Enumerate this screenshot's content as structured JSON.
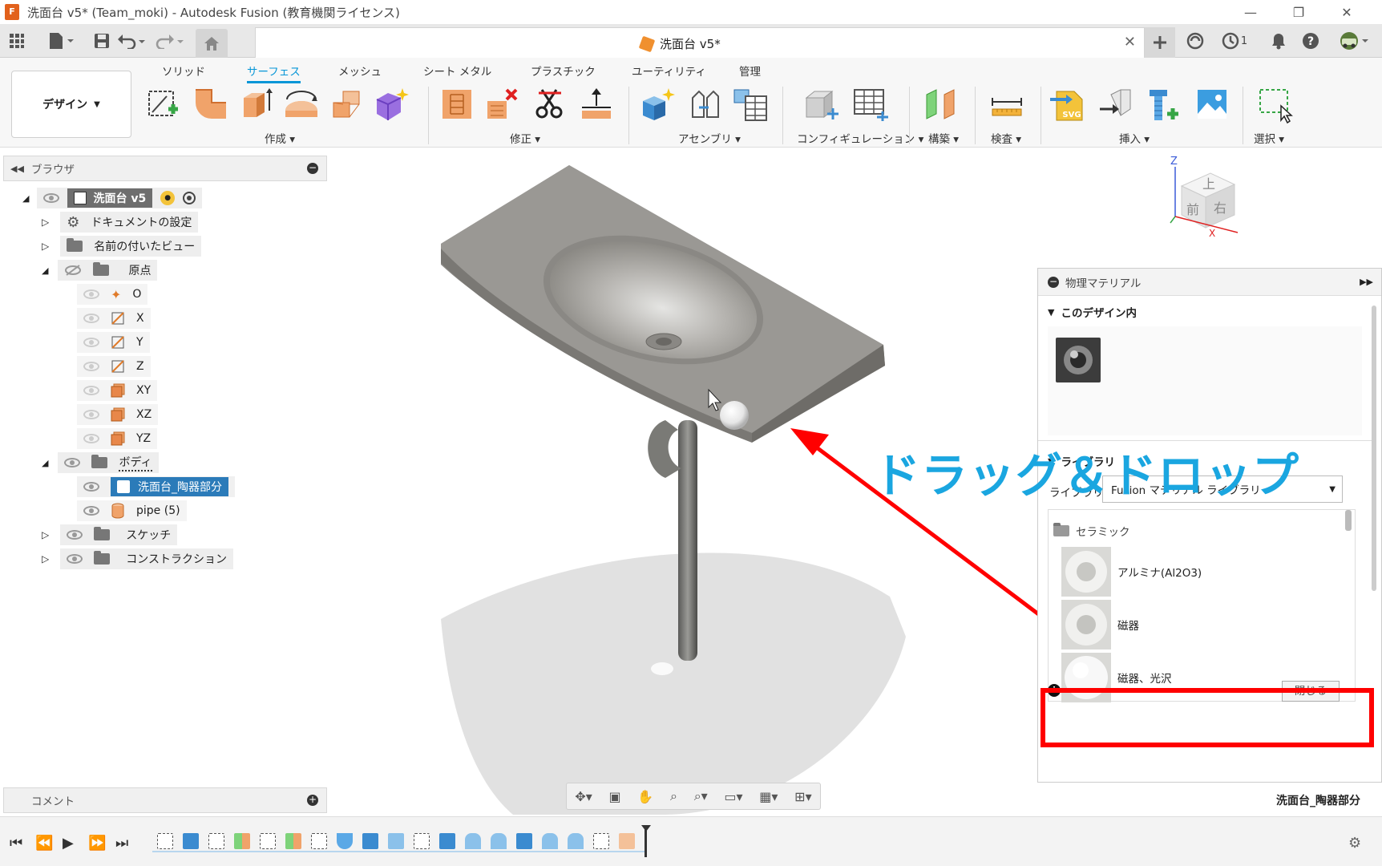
{
  "window": {
    "title": "洗面台 v5* (Team_moki) - Autodesk Fusion (教育機関ライセンス)",
    "app_icon_label": "F"
  },
  "document_tab": {
    "title": "洗面台 v5*"
  },
  "qat": {
    "job_count": "1"
  },
  "ribbon": {
    "workspace": "デザイン",
    "tabs": [
      "ソリッド",
      "サーフェス",
      "メッシュ",
      "シート メタル",
      "プラスチック",
      "ユーティリティ",
      "管理"
    ],
    "active_tab": "サーフェス",
    "groups": {
      "create": "作成",
      "modify": "修正",
      "assemble": "アセンブリ",
      "configure": "コンフィギュレーション",
      "construct": "構築",
      "inspect": "検査",
      "insert": "挿入",
      "select": "選択"
    }
  },
  "browser": {
    "title": "ブラウザ",
    "root": "洗面台 v5",
    "items": {
      "doc_settings": "ドキュメントの設定",
      "named_views": "名前の付いたビュー",
      "origin": "原点",
      "origin_o": "O",
      "origin_x": "X",
      "origin_y": "Y",
      "origin_z": "Z",
      "origin_xy": "XY",
      "origin_xz": "XZ",
      "origin_yz": "YZ",
      "bodies": "ボディ",
      "body1": "洗面台_陶器部分",
      "body2": "pipe (5)",
      "sketches": "スケッチ",
      "construction": "コンストラクション"
    }
  },
  "comment": {
    "title": "コメント"
  },
  "viewcube": {
    "top": "上",
    "front": "前",
    "right": "右",
    "axis_z": "Z",
    "axis_x": "X"
  },
  "material_panel": {
    "title": "物理マテリアル",
    "in_design": "このデザイン内",
    "library_section": "ライブラリ",
    "library_label": "ライブラリ",
    "library_value": "Fusion マテリアル ライブラリ",
    "category": "セラミック",
    "materials": [
      "アルミナ(Al2O3)",
      "磁器",
      "磁器、光沢"
    ],
    "close": "閉じる"
  },
  "annotation": {
    "text": "ドラッグ＆ドロップ"
  },
  "status": {
    "selection": "洗面台_陶器部分"
  },
  "colors": {
    "accent": "#0696d7",
    "callout": "#1aa6e0",
    "highlight": "#ff0000",
    "fusion_orange": "#e2611c"
  }
}
